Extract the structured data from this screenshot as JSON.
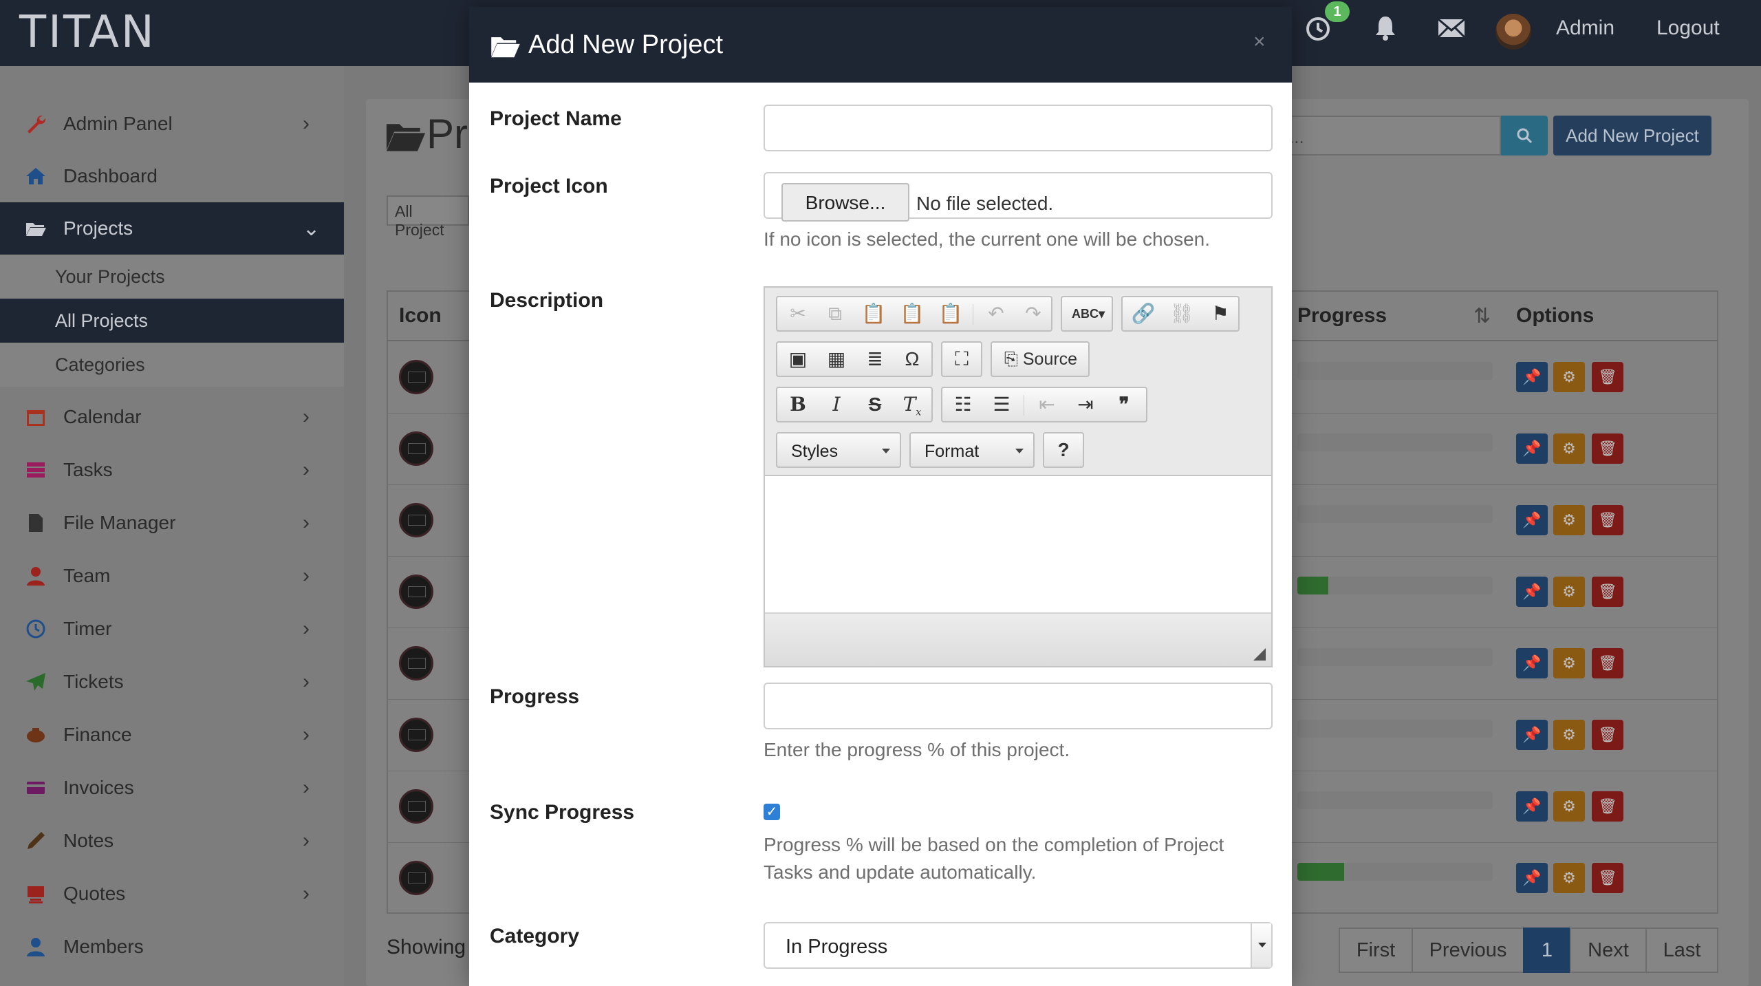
{
  "app": {
    "brand": "TITAN"
  },
  "topbar": {
    "timer_badge": "1",
    "user_label": "Admin",
    "logout_label": "Logout"
  },
  "sidebar": {
    "items": [
      {
        "label": "Admin Panel",
        "icon": "wrench-icon",
        "color": "#c0392b"
      },
      {
        "label": "Dashboard",
        "icon": "home-icon",
        "color": "#1f5fa8"
      },
      {
        "label": "Projects",
        "icon": "folder-open-icon",
        "color": "#c9ccd2"
      },
      {
        "label": "Calendar",
        "icon": "calendar-icon",
        "color": "#c0392b"
      },
      {
        "label": "Tasks",
        "icon": "tasks-icon",
        "color": "#b0186e"
      },
      {
        "label": "File Manager",
        "icon": "file-icon",
        "color": "#333333"
      },
      {
        "label": "Team",
        "icon": "user-icon",
        "color": "#b02a25"
      },
      {
        "label": "Timer",
        "icon": "clock-icon",
        "color": "#1f5fa8"
      },
      {
        "label": "Tickets",
        "icon": "paper-plane-icon",
        "color": "#2e7a2e"
      },
      {
        "label": "Finance",
        "icon": "finance-icon",
        "color": "#7d3b1a"
      },
      {
        "label": "Invoices",
        "icon": "credit-card-icon",
        "color": "#7a1b6e"
      },
      {
        "label": "Notes",
        "icon": "pencil-icon",
        "color": "#5a3a1a"
      },
      {
        "label": "Quotes",
        "icon": "quotes-icon",
        "color": "#b02a25"
      },
      {
        "label": "Members",
        "icon": "member-icon",
        "color": "#1f5fa8"
      }
    ],
    "subitems": [
      {
        "label": "Your Projects"
      },
      {
        "label": "All Projects"
      },
      {
        "label": "Categories"
      }
    ]
  },
  "background": {
    "page_title": "Pr",
    "filter_value": "All Project",
    "search_placeholder": "...",
    "add_button": "Add New Project",
    "columns": {
      "icon": "Icon",
      "progress": "Progress",
      "options": "Options"
    },
    "rows": [
      {
        "progress": 0
      },
      {
        "progress": 0
      },
      {
        "progress": 0
      },
      {
        "progress": 0.16
      },
      {
        "progress": 0
      },
      {
        "progress": 0
      },
      {
        "progress": 0
      },
      {
        "progress": 0.24
      }
    ],
    "showing_text": "Showing",
    "pagination": [
      "First",
      "Previous",
      "1",
      "Next",
      "Last"
    ]
  },
  "modal": {
    "title": "Add New Project",
    "close_label": "×",
    "fields": {
      "project_name_label": "Project Name",
      "project_name_value": "",
      "project_icon_label": "Project Icon",
      "browse_label": "Browse...",
      "file_status": "No file selected.",
      "icon_help": "If no icon is selected, the current one will be chosen.",
      "description_label": "Description",
      "progress_label": "Progress",
      "progress_value": "",
      "progress_help": "Enter the progress % of this project.",
      "sync_label": "Sync Progress",
      "sync_checked": true,
      "sync_help": "Progress % will be based on the completion of Project Tasks and update automatically.",
      "category_label": "Category",
      "category_value": "In Progress"
    },
    "editor": {
      "source_label": "Source",
      "styles_label": "Styles",
      "format_label": "Format",
      "help_label": "?"
    }
  }
}
